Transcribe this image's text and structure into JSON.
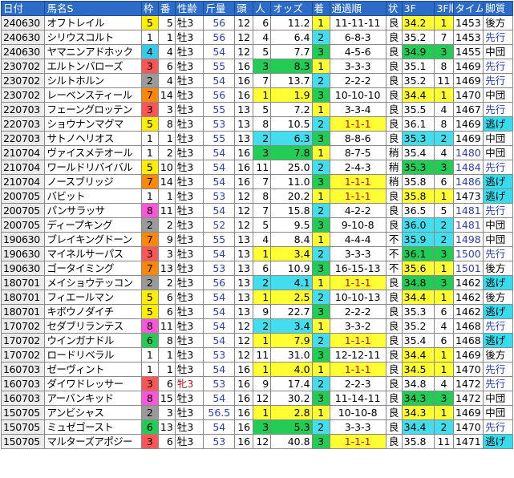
{
  "headers": [
    "日付",
    "馬名S",
    "枠",
    "番",
    "性齢",
    "斤量",
    "頭",
    "人",
    "オッズ",
    "着",
    "通過順",
    "状",
    "3F",
    "3F順",
    "タイム",
    "脚質"
  ],
  "colors": {
    "header_bg": "#2c6cc8",
    "waku": {
      "1": "#ffffff",
      "2": "#9a9a9a",
      "3": "#ff5555",
      "4": "#33ccee",
      "5": "#ffee00",
      "6": "#22cc55",
      "7": "#ff8800",
      "8": "#ff55dd"
    },
    "rank1": "#ffff33",
    "rank2": "#44ddee",
    "rank3": "#22cc55",
    "kyakushitsu_highlight": "#33ddee",
    "date_bg": "#ececec"
  },
  "rows": [
    {
      "date": "240630",
      "name": "オフトレイル",
      "waku": "5",
      "ban": "5",
      "sexage": "牡3",
      "kinryo": "56",
      "to": "12",
      "nin": "6",
      "odds": "11.2",
      "chaku": "1",
      "tsuka": "11-11-11",
      "jou": "良",
      "f3": "34.2",
      "f3j": "1",
      "time": "1453",
      "kyaku": "後方",
      "kyaku_hl": false
    },
    {
      "date": "240630",
      "name": "シリウスコルト",
      "waku": "1",
      "ban": "1",
      "sexage": "牡3",
      "kinryo": "56",
      "to": "12",
      "nin": "4",
      "odds": "6.4",
      "chaku": "2",
      "tsuka": "6-8-3",
      "jou": "良",
      "f3": "35.2",
      "f3j": "7",
      "time": "1453",
      "kyaku": "先行",
      "kyaku_hl": false
    },
    {
      "date": "240630",
      "name": "ヤマニンアドホック",
      "waku": "4",
      "ban": "4",
      "sexage": "牡3",
      "kinryo": "54",
      "to": "12",
      "nin": "5",
      "odds": "7.7",
      "chaku": "3",
      "tsuka": "4-5-6",
      "jou": "良",
      "f3": "34.9",
      "f3j": "3",
      "time": "1455",
      "kyaku": "中団",
      "kyaku_hl": false
    },
    {
      "date": "230702",
      "name": "エルトンバローズ",
      "waku": "3",
      "ban": "6",
      "sexage": "牡3",
      "kinryo": "55",
      "to": "16",
      "nin": "3",
      "odds": "8.3",
      "chaku": "1",
      "tsuka": "3-3-3",
      "jou": "良",
      "f3": "35.1",
      "f3j": "8",
      "time": "1469",
      "kyaku": "先行",
      "kyaku_hl": false
    },
    {
      "date": "230702",
      "name": "シルトホルン",
      "waku": "2",
      "ban": "4",
      "sexage": "牡3",
      "kinryo": "54",
      "to": "16",
      "nin": "7",
      "odds": "13.7",
      "chaku": "2",
      "tsuka": "2-2-2",
      "jou": "良",
      "f3": "35.2",
      "f3j": "11",
      "time": "1469",
      "kyaku": "先行",
      "kyaku_hl": false
    },
    {
      "date": "230702",
      "name": "レーベンスティール",
      "waku": "7",
      "ban": "14",
      "sexage": "牡3",
      "kinryo": "56",
      "to": "16",
      "nin": "1",
      "odds": "1.9",
      "chaku": "3",
      "tsuka": "10-10-10",
      "jou": "良",
      "f3": "34.4",
      "f3j": "1",
      "time": "1470",
      "kyaku": "中団",
      "kyaku_hl": false
    },
    {
      "date": "220703",
      "name": "フェーングロッテン",
      "waku": "3",
      "ban": "3",
      "sexage": "牡3",
      "kinryo": "55",
      "to": "13",
      "nin": "5",
      "odds": "7.2",
      "chaku": "1",
      "tsuka": "3-3-4",
      "jou": "良",
      "f3": "35.5",
      "f3j": "4",
      "time": "1467",
      "kyaku": "先行",
      "kyaku_hl": false
    },
    {
      "date": "220703",
      "name": "ショウナンマグマ",
      "waku": "5",
      "ban": "8",
      "sexage": "牡3",
      "kinryo": "53",
      "to": "13",
      "nin": "8",
      "odds": "10.5",
      "chaku": "2",
      "tsuka": "1-1-1",
      "jou": "良",
      "f3": "36.1",
      "f3j": "8",
      "time": "1469",
      "kyaku": "逃げ",
      "kyaku_hl": true
    },
    {
      "date": "220703",
      "name": "サトノヘリオス",
      "waku": "1",
      "ban": "1",
      "sexage": "牡3",
      "kinryo": "55",
      "to": "13",
      "nin": "2",
      "odds": "6.3",
      "chaku": "3",
      "tsuka": "8-8-6",
      "jou": "良",
      "f3": "35.3",
      "f3j": "2",
      "time": "1469",
      "kyaku": "中団",
      "kyaku_hl": false
    },
    {
      "date": "210704",
      "name": "ヴァイスメテオール",
      "waku": "1",
      "ban": "2",
      "sexage": "牡3",
      "kinryo": "54",
      "to": "16",
      "nin": "3",
      "odds": "7.8",
      "chaku": "1",
      "tsuka": "8-7-5",
      "jou": "稍",
      "f3": "35.4",
      "f3j": "4",
      "time": "1480",
      "kyaku": "中団",
      "kyaku_hl": false
    },
    {
      "date": "210704",
      "name": "ワールドリバイバル",
      "waku": "5",
      "ban": "10",
      "sexage": "牡3",
      "kinryo": "54",
      "to": "16",
      "nin": "11",
      "odds": "25.0",
      "chaku": "2",
      "tsuka": "2-4-3",
      "jou": "稍",
      "f3": "35.3",
      "f3j": "3",
      "time": "1484",
      "kyaku": "先行",
      "kyaku_hl": false
    },
    {
      "date": "210704",
      "name": "ノースブリッジ",
      "waku": "7",
      "ban": "14",
      "sexage": "牡3",
      "kinryo": "54",
      "to": "16",
      "nin": "7",
      "odds": "11.0",
      "chaku": "3",
      "tsuka": "1-1-1",
      "jou": "稍",
      "f3": "35.8",
      "f3j": "6",
      "time": "1486",
      "kyaku": "逃げ",
      "kyaku_hl": true
    },
    {
      "date": "200705",
      "name": "バビット",
      "waku": "1",
      "ban": "1",
      "sexage": "牡3",
      "kinryo": "53",
      "to": "12",
      "nin": "8",
      "odds": "20.2",
      "chaku": "1",
      "tsuka": "1-1-1",
      "jou": "良",
      "f3": "35.8",
      "f3j": "1",
      "time": "1473",
      "kyaku": "逃げ",
      "kyaku_hl": true
    },
    {
      "date": "200705",
      "name": "パンサラッサ",
      "waku": "8",
      "ban": "11",
      "sexage": "牡3",
      "kinryo": "54",
      "to": "12",
      "nin": "7",
      "odds": "15.8",
      "chaku": "2",
      "tsuka": "4-2-2",
      "jou": "良",
      "f3": "36.5",
      "f3j": "5",
      "time": "1481",
      "kyaku": "先行",
      "kyaku_hl": false
    },
    {
      "date": "200705",
      "name": "ディープキング",
      "waku": "2",
      "ban": "2",
      "sexage": "牡3",
      "kinryo": "52",
      "to": "12",
      "nin": "5",
      "odds": "9.5",
      "chaku": "3",
      "tsuka": "9-10-8",
      "jou": "良",
      "f3": "36.0",
      "f3j": "2",
      "time": "1481",
      "kyaku": "中団",
      "kyaku_hl": false
    },
    {
      "date": "190630",
      "name": "ブレイキングドーン",
      "waku": "7",
      "ban": "9",
      "sexage": "牡3",
      "kinryo": "55",
      "to": "13",
      "nin": "4",
      "odds": "8.4",
      "chaku": "1",
      "tsuka": "4-4-4",
      "jou": "不",
      "f3": "35.9",
      "f3j": "2",
      "time": "1498",
      "kyaku": "中団",
      "kyaku_hl": false
    },
    {
      "date": "190630",
      "name": "マイネルサーパス",
      "waku": "3",
      "ban": "3",
      "sexage": "牡3",
      "kinryo": "54",
      "to": "13",
      "nin": "1",
      "odds": "3.4",
      "chaku": "2",
      "tsuka": "3-3-3",
      "jou": "不",
      "f3": "36.1",
      "f3j": "3",
      "time": "1500",
      "kyaku": "先行",
      "kyaku_hl": false
    },
    {
      "date": "190630",
      "name": "ゴータイミング",
      "waku": "7",
      "ban": "13",
      "sexage": "牡3",
      "kinryo": "53",
      "to": "13",
      "nin": "6",
      "odds": "10.9",
      "chaku": "3",
      "tsuka": "16-15-13",
      "jou": "不",
      "f3": "35.6",
      "f3j": "1",
      "time": "1501",
      "kyaku": "後方",
      "kyaku_hl": false
    },
    {
      "date": "180701",
      "name": "メイショウテッコン",
      "waku": "2",
      "ban": "2",
      "sexage": "牡3",
      "kinryo": "56",
      "to": "13",
      "nin": "2",
      "odds": "4.1",
      "chaku": "1",
      "tsuka": "1-1-1",
      "jou": "良",
      "f3": "34.8",
      "f3j": "3",
      "time": "1462",
      "kyaku": "逃げ",
      "kyaku_hl": true
    },
    {
      "date": "180701",
      "name": "フィエールマン",
      "waku": "5",
      "ban": "6",
      "sexage": "牡3",
      "kinryo": "54",
      "to": "13",
      "nin": "1",
      "odds": "2.5",
      "chaku": "2",
      "tsuka": "10-10-13",
      "jou": "良",
      "f3": "34.4",
      "f3j": "1",
      "time": "1462",
      "kyaku": "後方",
      "kyaku_hl": false
    },
    {
      "date": "180701",
      "name": "キボウノダイチ",
      "waku": "5",
      "ban": "6",
      "sexage": "牡3",
      "kinryo": "54",
      "to": "13",
      "nin": "9",
      "odds": "22.7",
      "chaku": "3",
      "tsuka": "2-2-2",
      "jou": "良",
      "f3": "35.3",
      "f3j": "6",
      "time": "1462",
      "kyaku": "逃げ",
      "kyaku_hl": true
    },
    {
      "date": "170702",
      "name": "セダブリランテス",
      "waku": "8",
      "ban": "11",
      "sexage": "牡3",
      "kinryo": "54",
      "to": "12",
      "nin": "2",
      "odds": "3.4",
      "chaku": "1",
      "tsuka": "3-3-2",
      "jou": "良",
      "f3": "35.2",
      "f3j": "4",
      "time": "1468",
      "kyaku": "先行",
      "kyaku_hl": false
    },
    {
      "date": "170702",
      "name": "ウインガナドル",
      "waku": "6",
      "ban": "8",
      "sexage": "牡3",
      "kinryo": "54",
      "to": "12",
      "nin": "1",
      "odds": "7.9",
      "chaku": "2",
      "tsuka": "1-1-1",
      "jou": "良",
      "f3": "35.4",
      "f3j": "6",
      "time": "1468",
      "kyaku": "逃げ",
      "kyaku_hl": true
    },
    {
      "date": "170702",
      "name": "ロードリベラル",
      "waku": "1",
      "ban": "1",
      "sexage": "牡3",
      "kinryo": "53",
      "to": "12",
      "nin": "11",
      "odds": "31.0",
      "chaku": "3",
      "tsuka": "12-12-11",
      "jou": "良",
      "f3": "34.4",
      "f3j": "1",
      "time": "1469",
      "kyaku": "後方",
      "kyaku_hl": false
    },
    {
      "date": "160703",
      "name": "ゼーヴィント",
      "waku": "1",
      "ban": "1",
      "sexage": "牡3",
      "kinryo": "54",
      "to": "16",
      "nin": "1",
      "odds": "4.0",
      "chaku": "1",
      "tsuka": "1-1-1",
      "jou": "良",
      "f3": "34.5",
      "f3j": "1",
      "time": "1470",
      "kyaku": "先行",
      "kyaku_hl": false
    },
    {
      "date": "160703",
      "name": "ダイワドレッサー",
      "waku": "3",
      "ban": "6",
      "sexage": "牝3",
      "kinryo": "53",
      "to": "16",
      "nin": "9",
      "odds": "17.4",
      "chaku": "2",
      "tsuka": "2-2-3",
      "jou": "良",
      "f3": "34.8",
      "f3j": "4",
      "time": "1472",
      "kyaku": "先行",
      "kyaku_hl": false
    },
    {
      "date": "160703",
      "name": "アーバンキッド",
      "waku": "8",
      "ban": "15",
      "sexage": "牡3",
      "kinryo": "54",
      "to": "16",
      "nin": "12",
      "odds": "30.2",
      "chaku": "3",
      "tsuka": "11-14-11",
      "jou": "良",
      "f3": "34.3",
      "f3j": "3",
      "time": "1472",
      "kyaku": "中団",
      "kyaku_hl": false
    },
    {
      "date": "150705",
      "name": "アンビシャス",
      "waku": "2",
      "ban": "3",
      "sexage": "牡3",
      "kinryo": "56.5",
      "to": "16",
      "nin": "1",
      "odds": "2.8",
      "chaku": "1",
      "tsuka": "10-10-8",
      "jou": "良",
      "f3": "34.3",
      "f3j": "1",
      "time": "1469",
      "kyaku": "中団",
      "kyaku_hl": false
    },
    {
      "date": "150705",
      "name": "ミュゼゴースト",
      "waku": "6",
      "ban": "13",
      "sexage": "牡3",
      "kinryo": "54",
      "to": "16",
      "nin": "3",
      "odds": "5.3",
      "chaku": "2",
      "tsuka": "3-3-3",
      "jou": "良",
      "f3": "34.4",
      "f3j": "2",
      "time": "1470",
      "kyaku": "先行",
      "kyaku_hl": false
    },
    {
      "date": "150705",
      "name": "マルターズアポジー",
      "waku": "3",
      "ban": "6",
      "sexage": "牡3",
      "kinryo": "53",
      "to": "16",
      "nin": "12",
      "odds": "40.8",
      "chaku": "3",
      "tsuka": "1-1-1",
      "jou": "良",
      "f3": "35.8",
      "f3j": "11",
      "time": "1471",
      "kyaku": "逃げ",
      "kyaku_hl": true
    }
  ]
}
